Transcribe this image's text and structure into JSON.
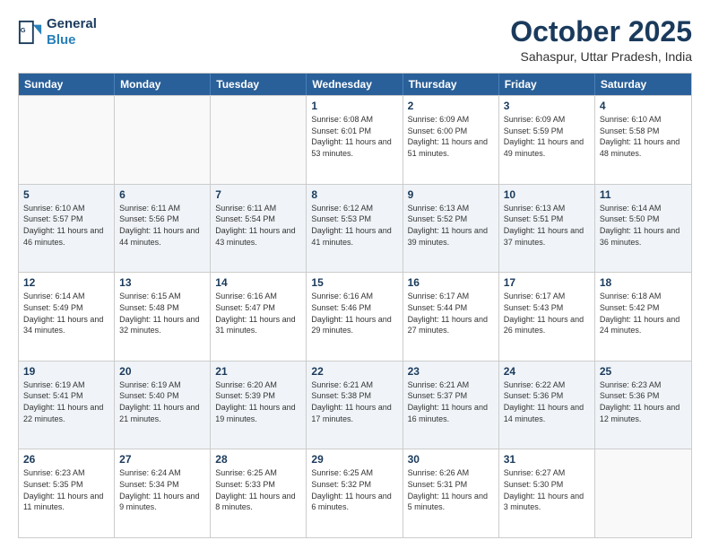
{
  "header": {
    "logo_line1": "General",
    "logo_line2": "Blue",
    "month": "October 2025",
    "location": "Sahaspur, Uttar Pradesh, India"
  },
  "weekdays": [
    "Sunday",
    "Monday",
    "Tuesday",
    "Wednesday",
    "Thursday",
    "Friday",
    "Saturday"
  ],
  "rows": [
    [
      {
        "day": "",
        "text": ""
      },
      {
        "day": "",
        "text": ""
      },
      {
        "day": "",
        "text": ""
      },
      {
        "day": "1",
        "text": "Sunrise: 6:08 AM\nSunset: 6:01 PM\nDaylight: 11 hours and 53 minutes."
      },
      {
        "day": "2",
        "text": "Sunrise: 6:09 AM\nSunset: 6:00 PM\nDaylight: 11 hours and 51 minutes."
      },
      {
        "day": "3",
        "text": "Sunrise: 6:09 AM\nSunset: 5:59 PM\nDaylight: 11 hours and 49 minutes."
      },
      {
        "day": "4",
        "text": "Sunrise: 6:10 AM\nSunset: 5:58 PM\nDaylight: 11 hours and 48 minutes."
      }
    ],
    [
      {
        "day": "5",
        "text": "Sunrise: 6:10 AM\nSunset: 5:57 PM\nDaylight: 11 hours and 46 minutes."
      },
      {
        "day": "6",
        "text": "Sunrise: 6:11 AM\nSunset: 5:56 PM\nDaylight: 11 hours and 44 minutes."
      },
      {
        "day": "7",
        "text": "Sunrise: 6:11 AM\nSunset: 5:54 PM\nDaylight: 11 hours and 43 minutes."
      },
      {
        "day": "8",
        "text": "Sunrise: 6:12 AM\nSunset: 5:53 PM\nDaylight: 11 hours and 41 minutes."
      },
      {
        "day": "9",
        "text": "Sunrise: 6:13 AM\nSunset: 5:52 PM\nDaylight: 11 hours and 39 minutes."
      },
      {
        "day": "10",
        "text": "Sunrise: 6:13 AM\nSunset: 5:51 PM\nDaylight: 11 hours and 37 minutes."
      },
      {
        "day": "11",
        "text": "Sunrise: 6:14 AM\nSunset: 5:50 PM\nDaylight: 11 hours and 36 minutes."
      }
    ],
    [
      {
        "day": "12",
        "text": "Sunrise: 6:14 AM\nSunset: 5:49 PM\nDaylight: 11 hours and 34 minutes."
      },
      {
        "day": "13",
        "text": "Sunrise: 6:15 AM\nSunset: 5:48 PM\nDaylight: 11 hours and 32 minutes."
      },
      {
        "day": "14",
        "text": "Sunrise: 6:16 AM\nSunset: 5:47 PM\nDaylight: 11 hours and 31 minutes."
      },
      {
        "day": "15",
        "text": "Sunrise: 6:16 AM\nSunset: 5:46 PM\nDaylight: 11 hours and 29 minutes."
      },
      {
        "day": "16",
        "text": "Sunrise: 6:17 AM\nSunset: 5:44 PM\nDaylight: 11 hours and 27 minutes."
      },
      {
        "day": "17",
        "text": "Sunrise: 6:17 AM\nSunset: 5:43 PM\nDaylight: 11 hours and 26 minutes."
      },
      {
        "day": "18",
        "text": "Sunrise: 6:18 AM\nSunset: 5:42 PM\nDaylight: 11 hours and 24 minutes."
      }
    ],
    [
      {
        "day": "19",
        "text": "Sunrise: 6:19 AM\nSunset: 5:41 PM\nDaylight: 11 hours and 22 minutes."
      },
      {
        "day": "20",
        "text": "Sunrise: 6:19 AM\nSunset: 5:40 PM\nDaylight: 11 hours and 21 minutes."
      },
      {
        "day": "21",
        "text": "Sunrise: 6:20 AM\nSunset: 5:39 PM\nDaylight: 11 hours and 19 minutes."
      },
      {
        "day": "22",
        "text": "Sunrise: 6:21 AM\nSunset: 5:38 PM\nDaylight: 11 hours and 17 minutes."
      },
      {
        "day": "23",
        "text": "Sunrise: 6:21 AM\nSunset: 5:37 PM\nDaylight: 11 hours and 16 minutes."
      },
      {
        "day": "24",
        "text": "Sunrise: 6:22 AM\nSunset: 5:36 PM\nDaylight: 11 hours and 14 minutes."
      },
      {
        "day": "25",
        "text": "Sunrise: 6:23 AM\nSunset: 5:36 PM\nDaylight: 11 hours and 12 minutes."
      }
    ],
    [
      {
        "day": "26",
        "text": "Sunrise: 6:23 AM\nSunset: 5:35 PM\nDaylight: 11 hours and 11 minutes."
      },
      {
        "day": "27",
        "text": "Sunrise: 6:24 AM\nSunset: 5:34 PM\nDaylight: 11 hours and 9 minutes."
      },
      {
        "day": "28",
        "text": "Sunrise: 6:25 AM\nSunset: 5:33 PM\nDaylight: 11 hours and 8 minutes."
      },
      {
        "day": "29",
        "text": "Sunrise: 6:25 AM\nSunset: 5:32 PM\nDaylight: 11 hours and 6 minutes."
      },
      {
        "day": "30",
        "text": "Sunrise: 6:26 AM\nSunset: 5:31 PM\nDaylight: 11 hours and 5 minutes."
      },
      {
        "day": "31",
        "text": "Sunrise: 6:27 AM\nSunset: 5:30 PM\nDaylight: 11 hours and 3 minutes."
      },
      {
        "day": "",
        "text": ""
      }
    ]
  ]
}
